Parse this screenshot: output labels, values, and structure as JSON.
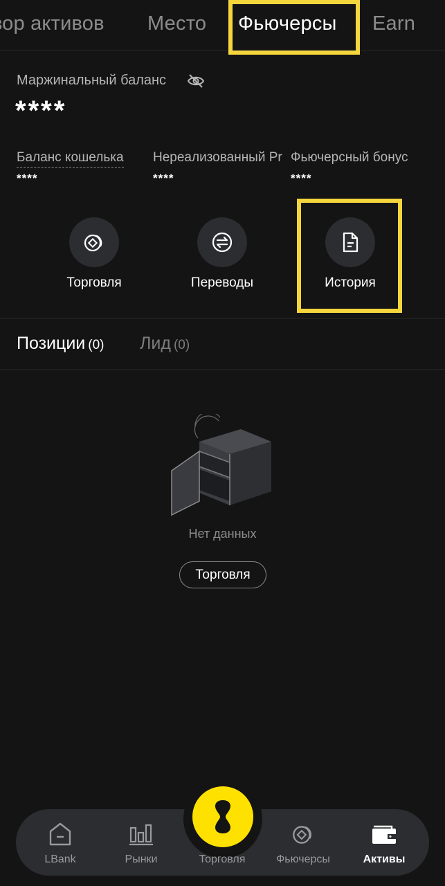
{
  "top_tabs": {
    "overview": "зор активов",
    "spot": "Место",
    "futures": "Фьючерсы",
    "earn": "Earn"
  },
  "balance": {
    "label": "Маржинальный баланс",
    "value": "****"
  },
  "sub_balances": [
    {
      "label": "Баланс кошелька",
      "value": "****"
    },
    {
      "label": "Нереализованный Pr",
      "value": "****"
    },
    {
      "label": "Фьючерсный бонус",
      "value": "****"
    }
  ],
  "actions": {
    "trade": "Торговля",
    "transfers": "Переводы",
    "history": "История"
  },
  "position_tabs": {
    "positions_label": "Позиции",
    "positions_count": "(0)",
    "lead_label": "Лид",
    "lead_count": "(0)"
  },
  "empty_state": {
    "text": "Нет данных",
    "button": "Торговля"
  },
  "bottom_nav": {
    "lbank": "LBank",
    "markets": "Рынки",
    "trade": "Торговля",
    "futures": "Фьючерсы",
    "assets": "Активы"
  },
  "colors": {
    "background": "#141414",
    "highlight": "#f5d63d",
    "accent_yellow": "#ffe100",
    "card": "#2b2d31"
  }
}
